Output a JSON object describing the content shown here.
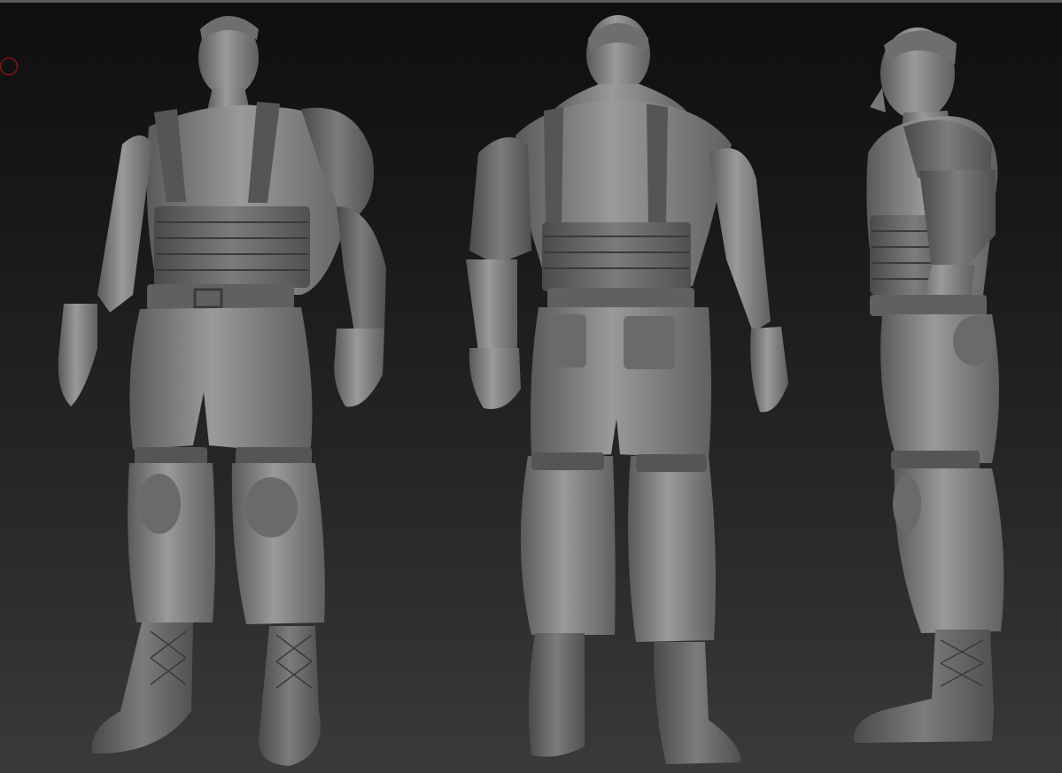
{
  "viewport": {
    "background_top": "#0f0f0f",
    "background_bottom": "#3a3a3a",
    "material_color": "#8a8a8a",
    "cursor_color": "#b0141a"
  },
  "views": [
    {
      "view": "front-three-quarter"
    },
    {
      "view": "back"
    },
    {
      "view": "side"
    }
  ]
}
